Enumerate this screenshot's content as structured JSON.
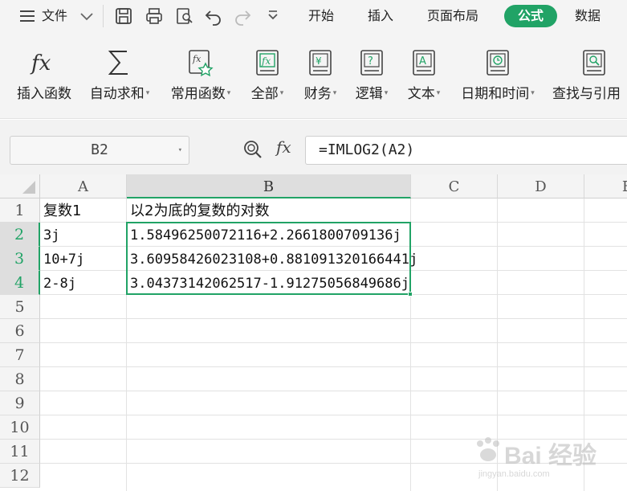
{
  "menu": {
    "file_label": "文件",
    "tabs": [
      "开始",
      "插入",
      "页面布局",
      "公式",
      "数据"
    ],
    "active_tab": "公式",
    "accent": "#21a366"
  },
  "ribbon": {
    "buttons": [
      {
        "label": "插入函数",
        "icon": "fx-icon",
        "dropdown": false
      },
      {
        "label": "自动求和",
        "icon": "sigma-icon",
        "dropdown": true
      },
      {
        "label": "常用函数",
        "icon": "star-function-icon",
        "dropdown": true
      },
      {
        "label": "全部",
        "icon": "book-fx-icon",
        "dropdown": true
      },
      {
        "label": "财务",
        "icon": "book-yen-icon",
        "dropdown": true
      },
      {
        "label": "逻辑",
        "icon": "book-question-icon",
        "dropdown": true
      },
      {
        "label": "文本",
        "icon": "book-a-icon",
        "dropdown": true
      },
      {
        "label": "日期和时间",
        "icon": "book-clock-icon",
        "dropdown": true
      },
      {
        "label": "查找与引用",
        "icon": "book-search-icon",
        "dropdown": false
      }
    ]
  },
  "formula_bar": {
    "name_box": "B2",
    "fx_label": "fx",
    "formula": "=IMLOG2(A2)"
  },
  "sheet": {
    "columns": [
      "A",
      "B",
      "C",
      "D",
      "E"
    ],
    "selected_column": "B",
    "rows": [
      "1",
      "2",
      "3",
      "4",
      "5",
      "6",
      "7",
      "8",
      "9",
      "10",
      "11",
      "12"
    ],
    "selected_rows": [
      "2",
      "3",
      "4"
    ],
    "cells": {
      "A1": "复数1",
      "B1": "以2为底的复数的对数",
      "A2": "3j",
      "B2": "1.58496250072116+2.2661800709136j",
      "A3": "10+7j",
      "B3": "3.60958426023108+0.881091320166441j",
      "A4": "2-8j",
      "B4": "3.04373142062517-1.91275056849686j"
    }
  },
  "watermark": {
    "text": "Bai 经验",
    "sub": "jingyan.baidu.com"
  }
}
